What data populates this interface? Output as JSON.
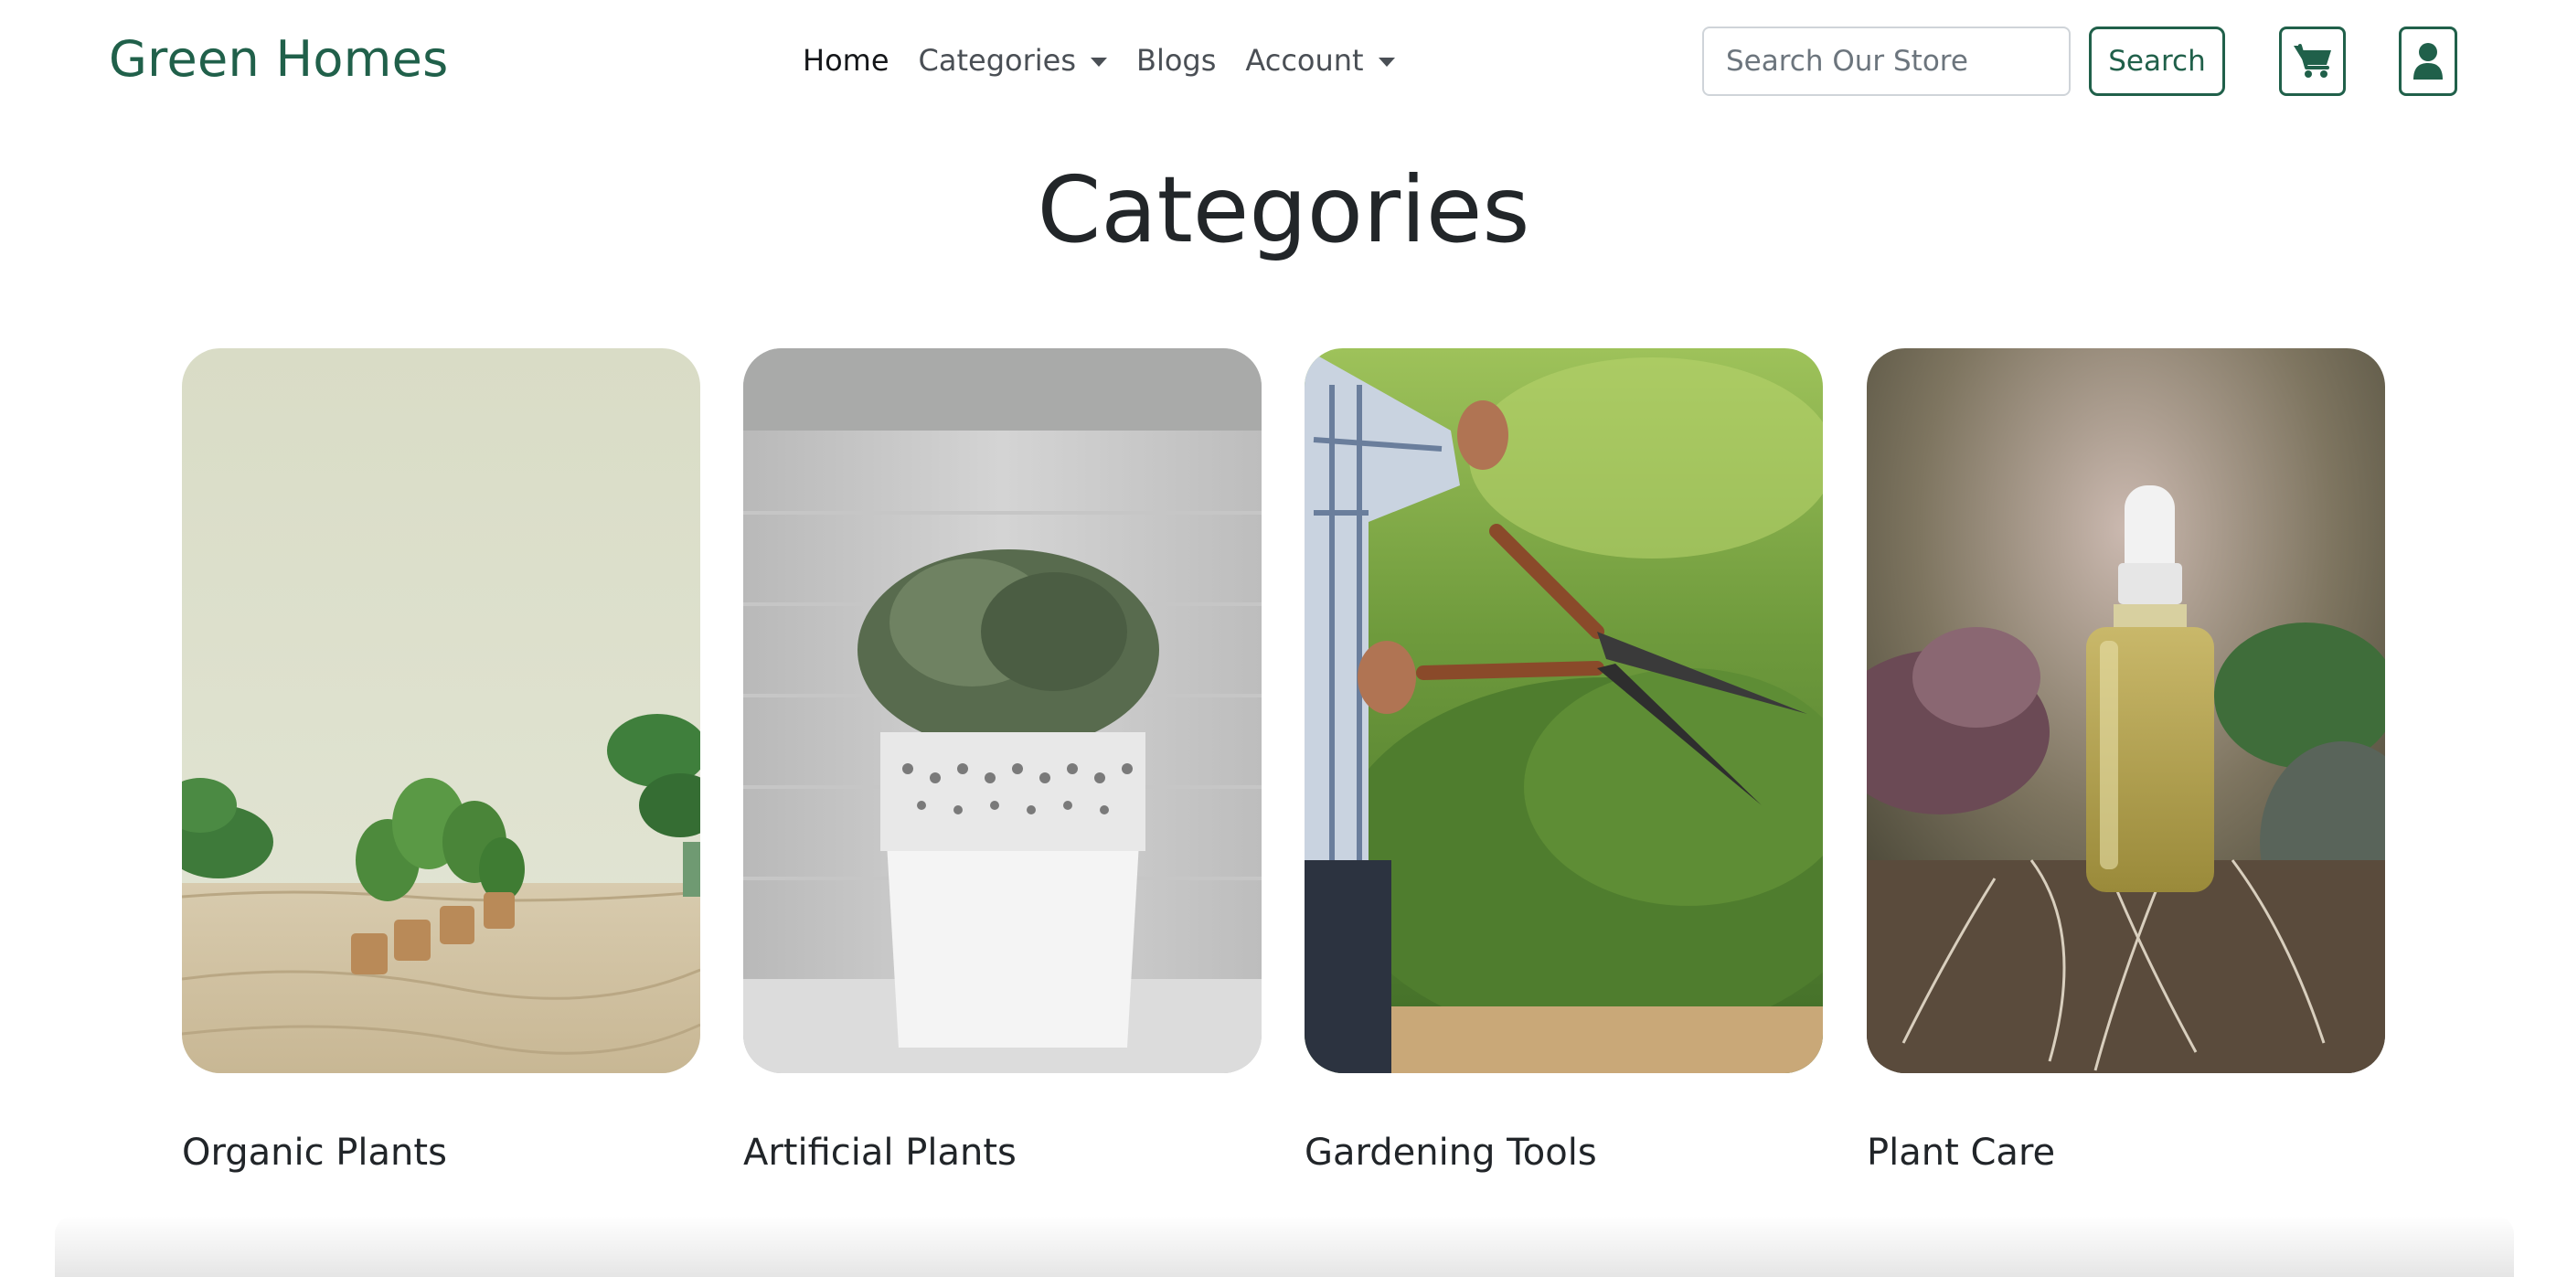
{
  "brand": "Green Homes",
  "nav": {
    "items": [
      {
        "label": "Home",
        "active": true,
        "dropdown": false
      },
      {
        "label": "Categories",
        "active": false,
        "dropdown": true
      },
      {
        "label": "Blogs",
        "active": false,
        "dropdown": false
      },
      {
        "label": "Account",
        "active": false,
        "dropdown": true
      }
    ]
  },
  "search": {
    "placeholder": "Search Our Store",
    "value": "",
    "button_label": "Search"
  },
  "icons": {
    "cart": "shopping-cart-icon",
    "user": "user-icon"
  },
  "page": {
    "title": "Categories"
  },
  "categories": [
    {
      "label": "Organic Plants"
    },
    {
      "label": "Artificial Plants"
    },
    {
      "label": "Gardening Tools"
    },
    {
      "label": "Plant Care"
    }
  ],
  "colors": {
    "brand": "#20604a",
    "text": "#212529",
    "nav_text": "#4a4f55"
  }
}
